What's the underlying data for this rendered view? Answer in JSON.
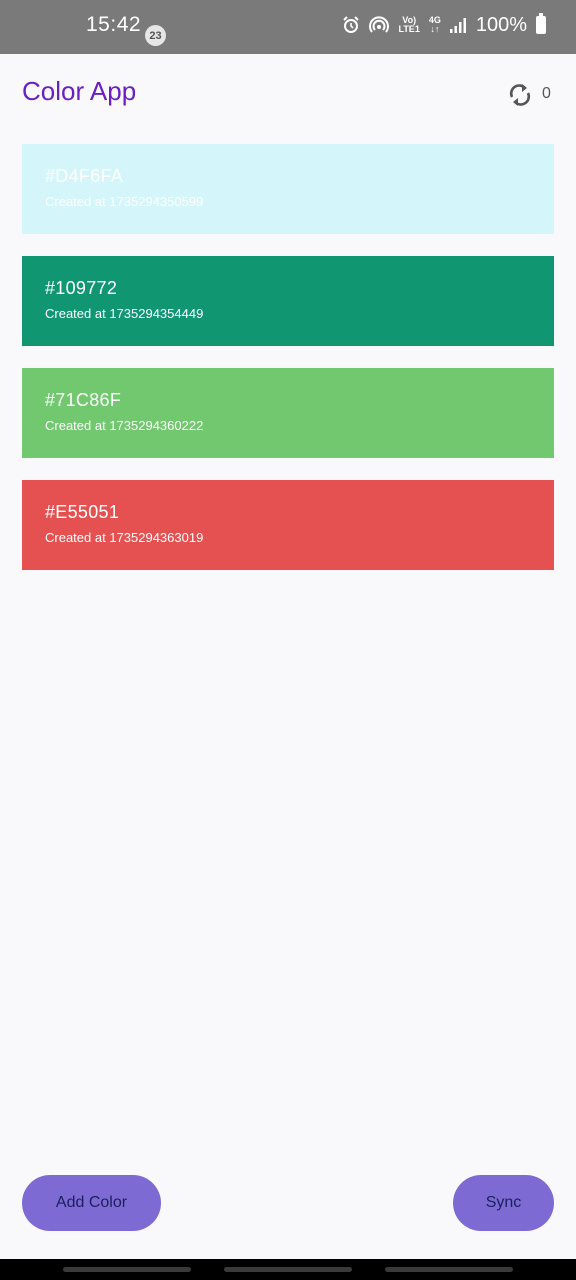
{
  "status_bar": {
    "time": "15:42",
    "notification_count": "23",
    "network_top": "Vo)",
    "network_bottom": "LTE1",
    "data_top": "4G",
    "data_bottom": "↓↑",
    "battery": "100%"
  },
  "header": {
    "title": "Color App",
    "sync_count": "0"
  },
  "colors": [
    {
      "hex": "#D4F6FA",
      "created": "Created at 1735294350599"
    },
    {
      "hex": "#109772",
      "created": "Created at 1735294354449"
    },
    {
      "hex": "#71C86F",
      "created": "Created at 1735294360222"
    },
    {
      "hex": "#E55051",
      "created": "Created at 1735294363019"
    }
  ],
  "actions": {
    "add_label": "Add Color",
    "sync_label": "Sync"
  },
  "theme": {
    "accent": "#6a1fc2",
    "button_bg": "#7d6bd3",
    "button_text": "#1b1f5e"
  }
}
